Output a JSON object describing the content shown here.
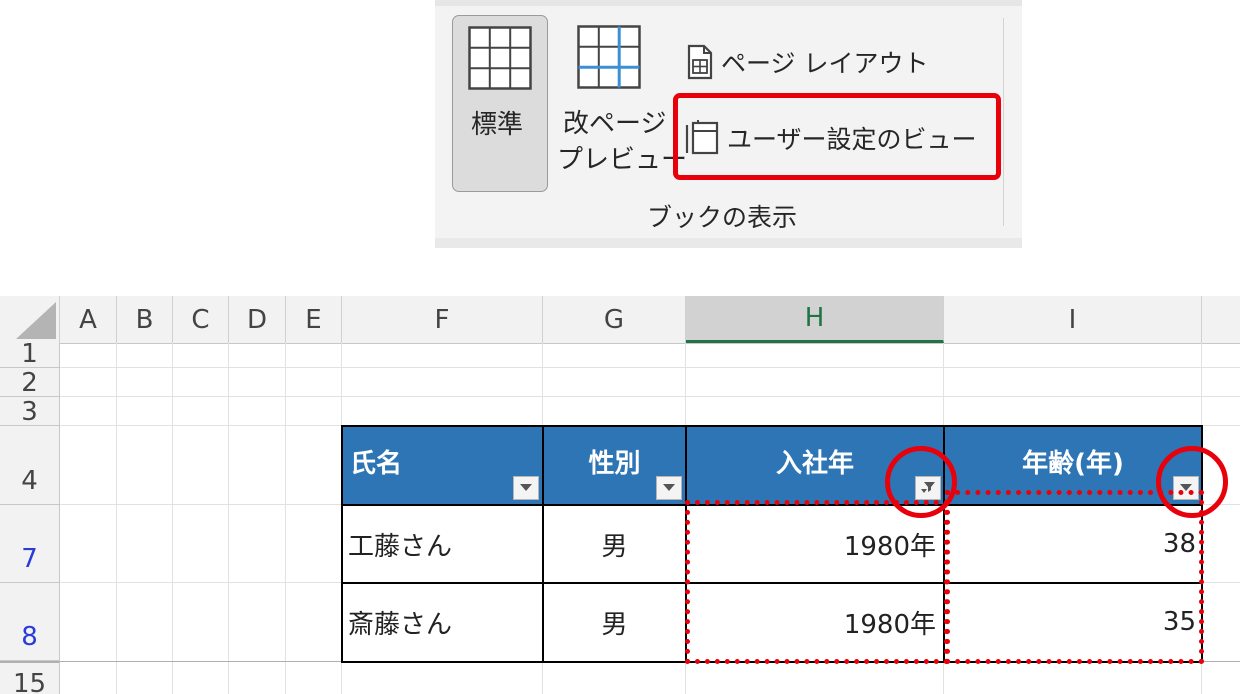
{
  "ribbon": {
    "standard_label": "標準",
    "page_break_label_line1": "改ページ",
    "page_break_label_line2": "プレビュー",
    "page_layout_label": "ページ レイアウト",
    "custom_views_label": "ユーザー設定のビュー",
    "group_label": "ブックの表示"
  },
  "sheet": {
    "columns": [
      "A",
      "B",
      "C",
      "D",
      "E",
      "F",
      "G",
      "H",
      "I"
    ],
    "selected_column": "H",
    "rows": [
      "1",
      "2",
      "3",
      "4",
      "7",
      "8",
      "15"
    ],
    "table": {
      "headers": [
        "氏名",
        "性別",
        "入社年",
        "年齢(年)"
      ],
      "rows": [
        [
          "工藤さん",
          "男",
          "1980年",
          "38"
        ],
        [
          "斎藤さん",
          "男",
          "1980年",
          "35"
        ]
      ]
    }
  },
  "colors": {
    "header_fill": "#2e75b6",
    "highlight": "#e8000b",
    "selected_column_accent": "#217346",
    "filtered_row_number": "#2a3bd8"
  },
  "icons": [
    "grid-view-icon",
    "page-break-icon",
    "page-layout-icon",
    "custom-views-icon",
    "filter-dropdown-icon",
    "filter-active-icon"
  ]
}
